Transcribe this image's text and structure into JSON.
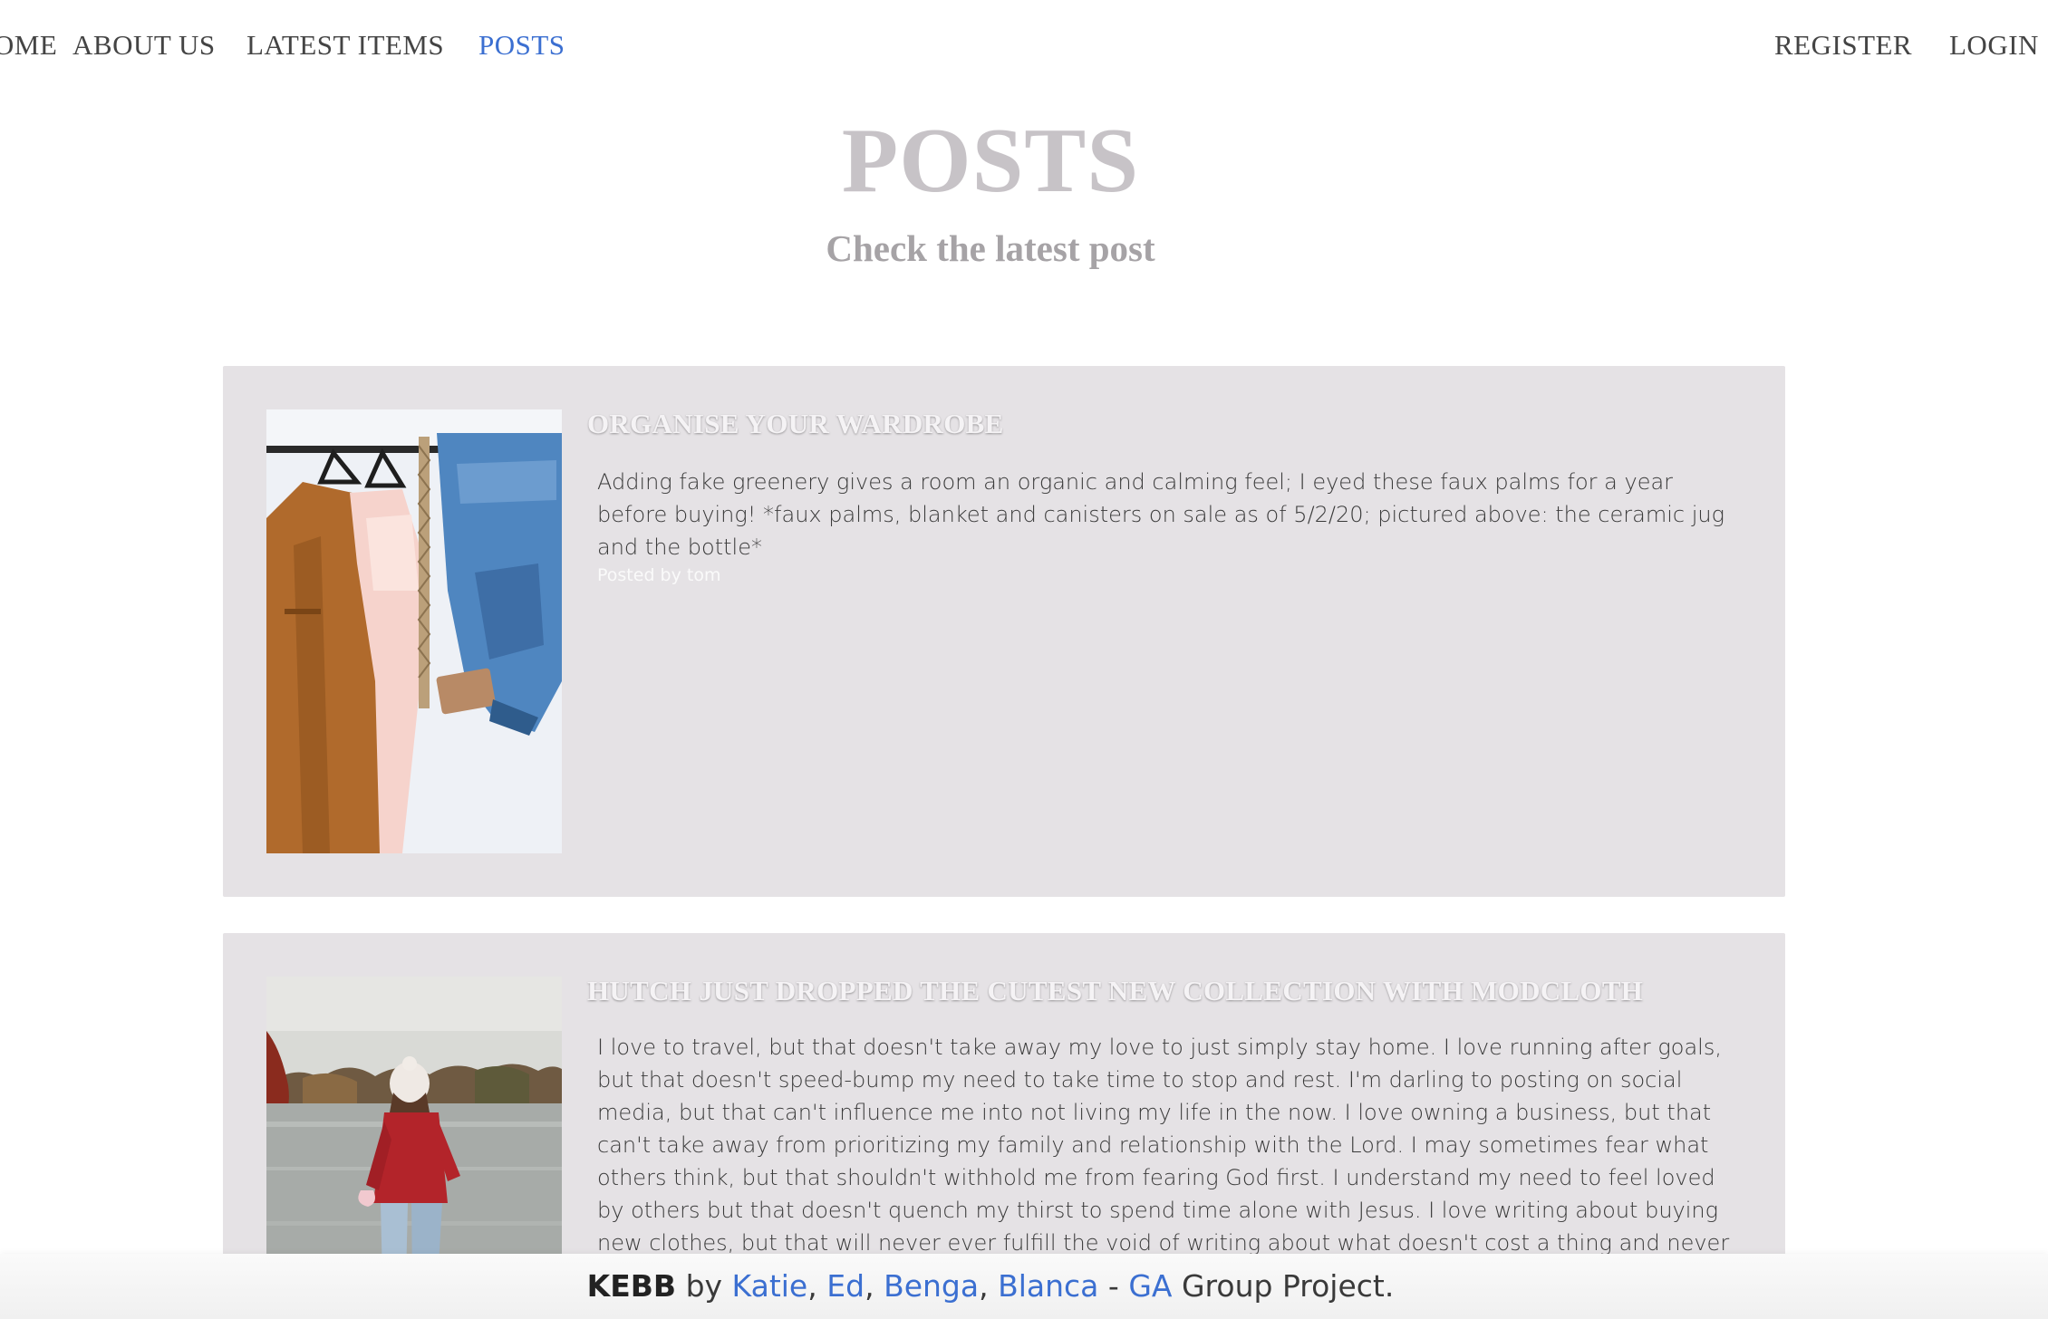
{
  "nav": {
    "left_items": [
      {
        "label": "HOME",
        "active": false
      },
      {
        "label": "ABOUT US",
        "active": false
      },
      {
        "label": "LATEST ITEMS",
        "active": false
      },
      {
        "label": "POSTS",
        "active": true
      }
    ],
    "right_items": [
      {
        "label": "REGISTER"
      },
      {
        "label": "LOGIN"
      }
    ],
    "active_color": "#3b6fd1"
  },
  "header": {
    "title": "POSTS",
    "subtitle": "Check the latest post"
  },
  "posts": [
    {
      "title": "ORGANISE YOUR WARDROBE",
      "body": "Adding fake greenery gives a room an organic and calming feel; I eyed these faux palms for a year before buying! *faux palms, blanket and canisters on sale as of 5/2/20; pictured above: the ceramic jug and the bottle*",
      "author": "Posted by tom",
      "image": "clothes-rack-photo"
    },
    {
      "title": "HUTCH JUST DROPPED THE CUTEST NEW COLLECTION WITH MODCLOTH",
      "body": "I love to travel, but that doesn't take away my love to just simply stay home. I love running after goals, but that doesn't speed-bump my need to take time to stop and rest. I'm darling to posting on social media, but that can't influence me into not living my life in the now. I love owning a business, but that can't take away from prioritizing my family and relationship with the Lord. I may sometimes fear what others think, but that shouldn't withhold me from fearing God first. I understand my need to feel loved by others but that doesn't quench my thirst to spend time alone with Jesus. I love writing about buying new clothes, but that will never ever fulfill the void of writing about what doesn't cost a thing and never sells out: Jesus. Let's not get caught",
      "image": "lake-woman-photo"
    }
  ],
  "footer": {
    "brand": "KEBB",
    "by": "by",
    "authors": [
      "Katie",
      "Ed",
      "Benga",
      "Blanca"
    ],
    "separator": ",",
    "dash": "-",
    "org": "GA",
    "suffix": "Group Project."
  }
}
